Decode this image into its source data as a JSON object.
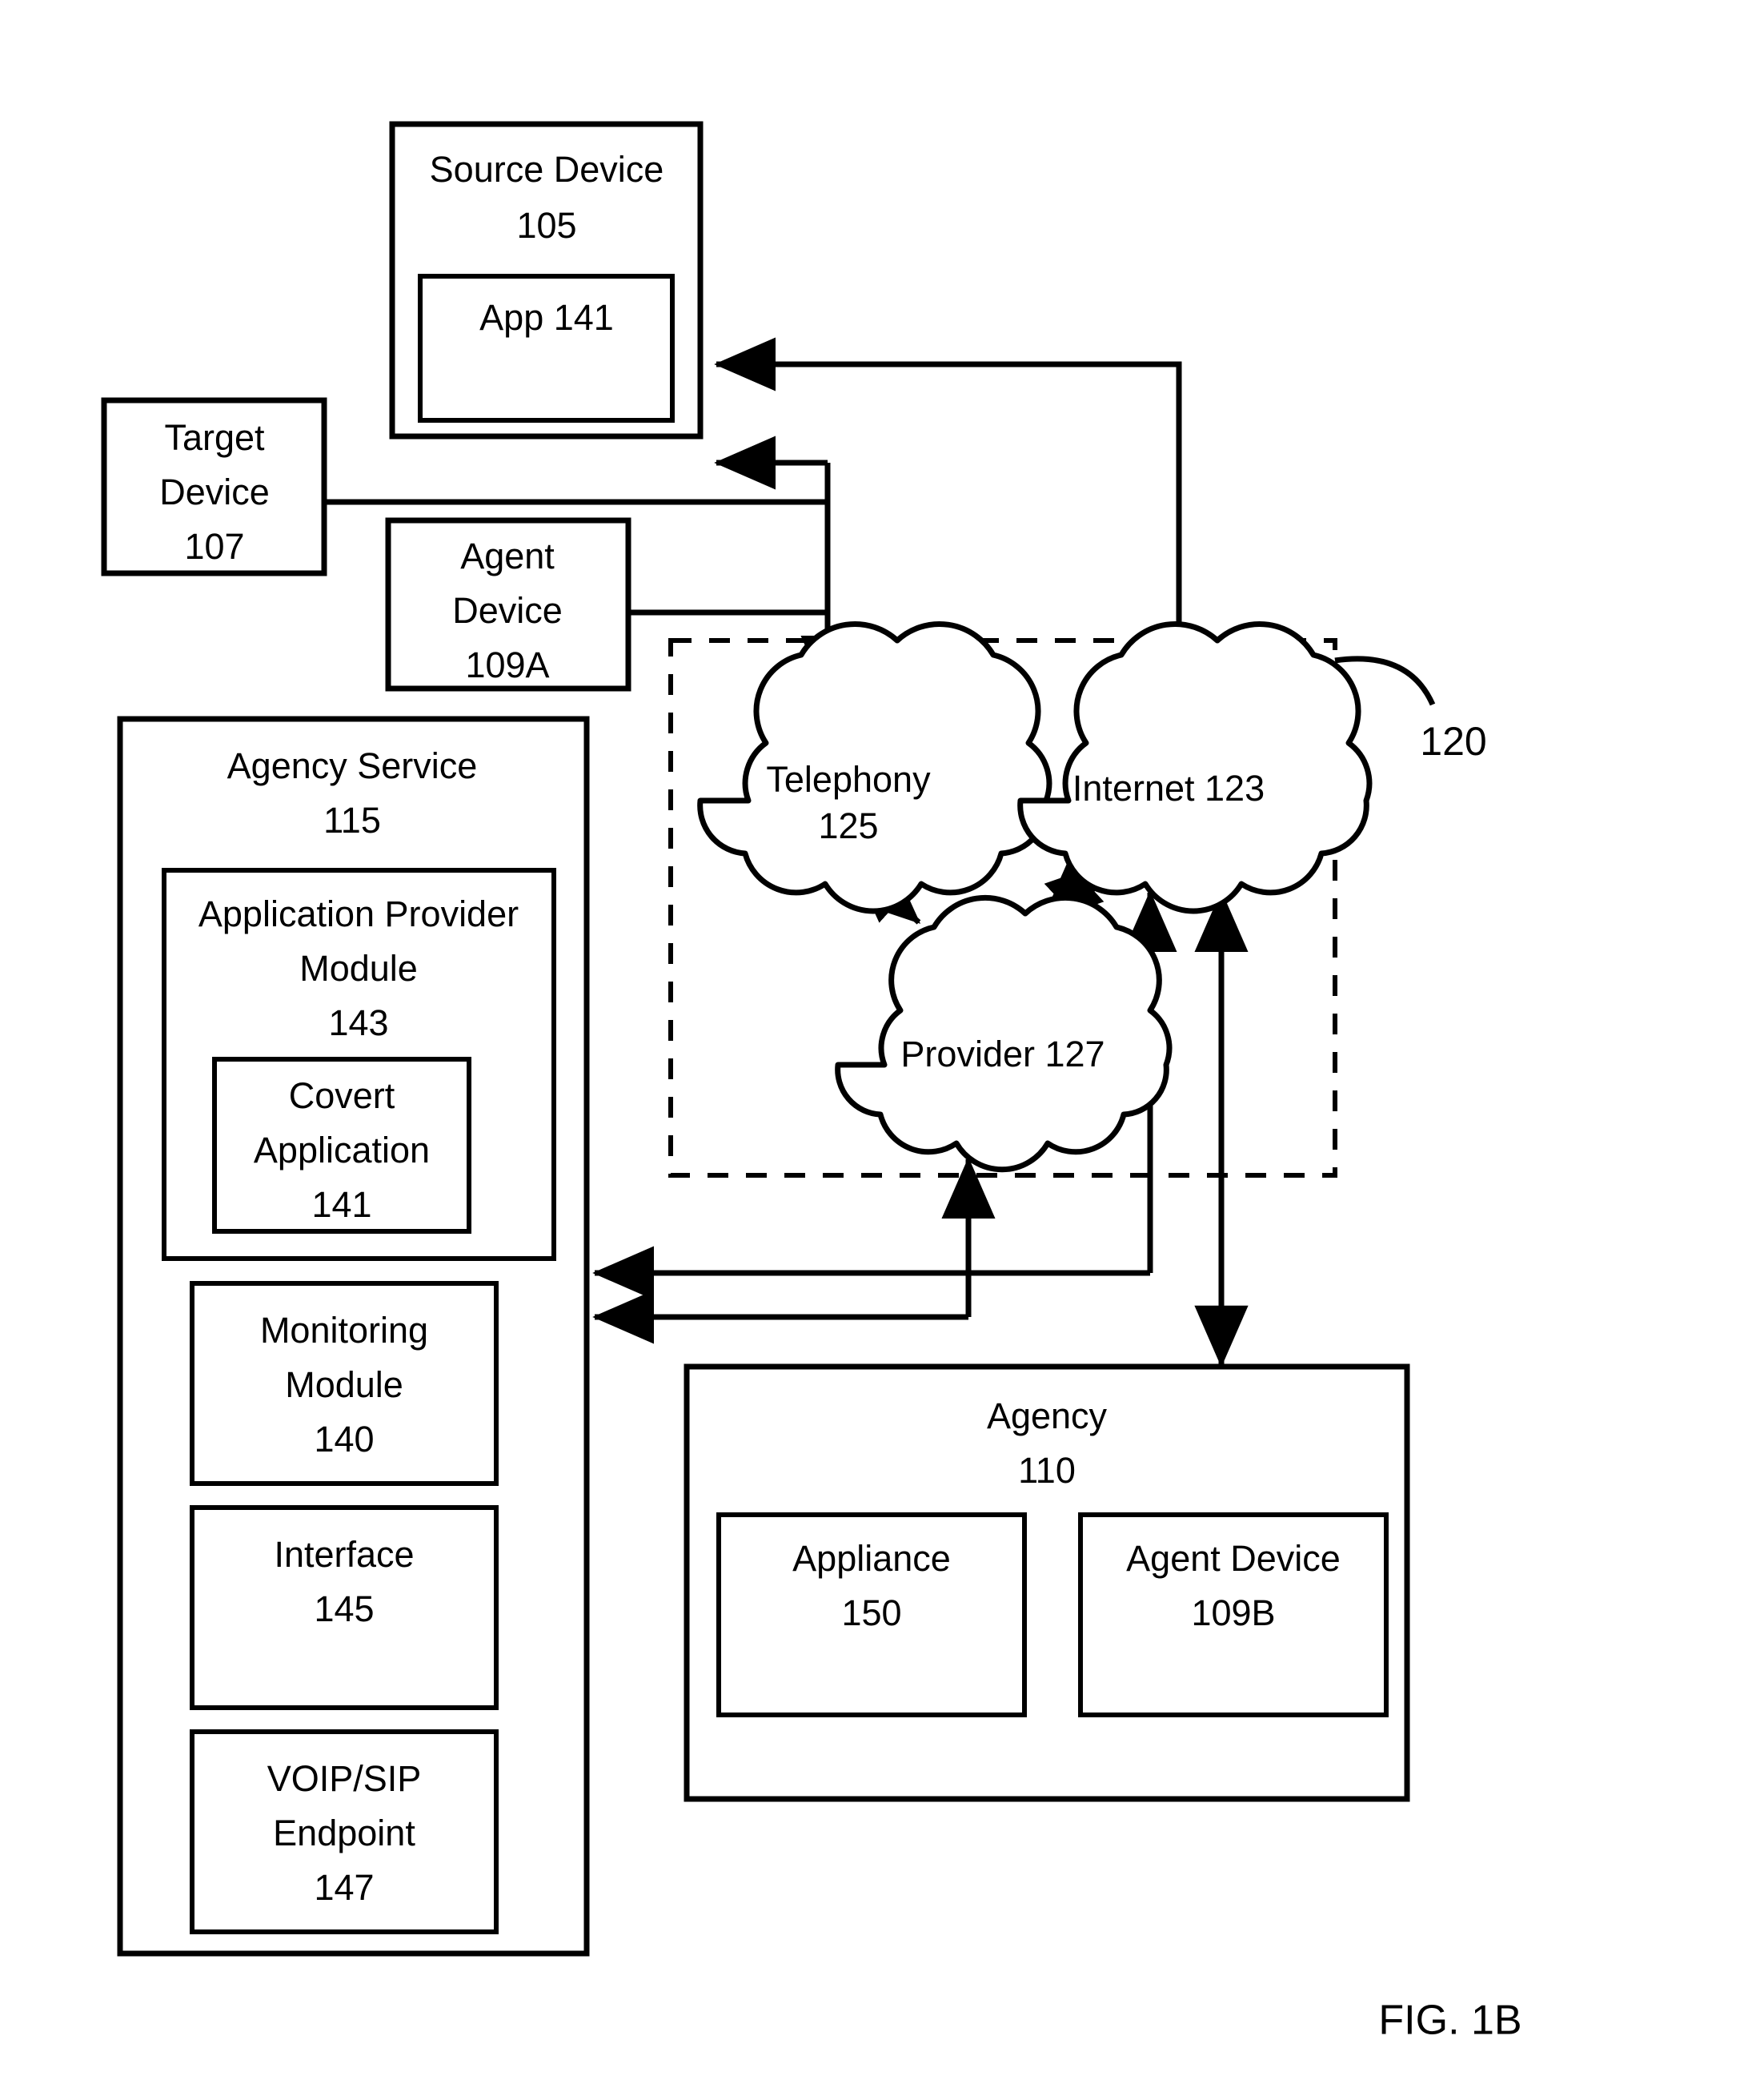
{
  "figure": {
    "caption": "FIG. 1B",
    "network_group_ref": "120"
  },
  "nodes": {
    "source_device": {
      "line1": "Source Device",
      "line2": "105"
    },
    "app": {
      "line1": "App 141"
    },
    "target_device": {
      "line1": "Target",
      "line2": "Device",
      "line3": "107"
    },
    "agent_device_a": {
      "line1": "Agent",
      "line2": "Device",
      "line3": "109A"
    },
    "agency_service": {
      "line1": "Agency Service",
      "line2": "115"
    },
    "application_provider_module": {
      "line1": "Application Provider",
      "line2": "Module",
      "line3": "143"
    },
    "covert_application": {
      "line1": "Covert",
      "line2": "Application",
      "line3": "141"
    },
    "monitoring_module": {
      "line1": "Monitoring",
      "line2": "Module",
      "line3": "140"
    },
    "interface": {
      "line1": "Interface",
      "line2": "145"
    },
    "voip_sip_endpoint": {
      "line1": "VOIP/SIP",
      "line2": "Endpoint",
      "line3": "147"
    },
    "telephony_cloud": {
      "line1": "Telephony",
      "line2": "125"
    },
    "internet_cloud": {
      "line1": "Internet 123"
    },
    "provider_cloud": {
      "line1": "Provider 127"
    },
    "agency": {
      "line1": "Agency",
      "line2": "110"
    },
    "appliance": {
      "line1": "Appliance",
      "line2": "150"
    },
    "agent_device_b": {
      "line1": "Agent Device",
      "line2": "109B"
    }
  },
  "colors": {
    "stroke": "#000000",
    "fill": "#ffffff"
  }
}
